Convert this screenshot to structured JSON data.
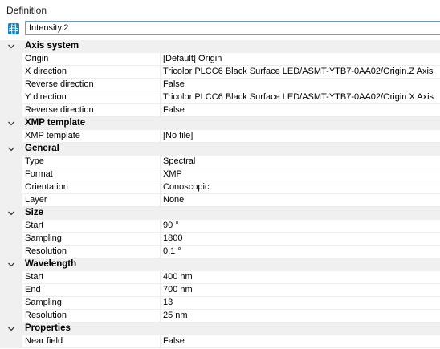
{
  "panel": {
    "title": "Definition"
  },
  "name_field": {
    "value": "Intensity.2",
    "icon": "sensor-icon"
  },
  "categories": [
    {
      "label": "Axis system",
      "rows": [
        {
          "name": "Origin",
          "value": "[Default] Origin"
        },
        {
          "name": "X direction",
          "value": "Tricolor PLCC6 Black Surface LED/ASMT-YTB7-0AA02/Origin.Z Axis"
        },
        {
          "name": "Reverse direction",
          "value": "False"
        },
        {
          "name": "Y direction",
          "value": "Tricolor PLCC6 Black Surface LED/ASMT-YTB7-0AA02/Origin.X Axis"
        },
        {
          "name": "Reverse direction",
          "value": "False"
        }
      ]
    },
    {
      "label": "XMP template",
      "rows": [
        {
          "name": "XMP template",
          "value": "[No file]"
        }
      ]
    },
    {
      "label": "General",
      "rows": [
        {
          "name": "Type",
          "value": "Spectral"
        },
        {
          "name": "Format",
          "value": "XMP"
        },
        {
          "name": "Orientation",
          "value": "Conoscopic"
        },
        {
          "name": "Layer",
          "value": "None"
        }
      ]
    },
    {
      "label": "Size",
      "rows": [
        {
          "name": "Start",
          "value": "90 °"
        },
        {
          "name": "Sampling",
          "value": "1800"
        },
        {
          "name": "Resolution",
          "value": "0.1 °"
        }
      ]
    },
    {
      "label": "Wavelength",
      "rows": [
        {
          "name": "Start",
          "value": "400 nm"
        },
        {
          "name": "End",
          "value": "700 nm"
        },
        {
          "name": "Sampling",
          "value": "13"
        },
        {
          "name": "Resolution",
          "value": "25 nm"
        }
      ]
    },
    {
      "label": "Properties",
      "rows": [
        {
          "name": "Near field",
          "value": "False"
        }
      ]
    }
  ],
  "colors": {
    "accent": "#0a84c6",
    "header_bg": "#f0f0f0"
  }
}
